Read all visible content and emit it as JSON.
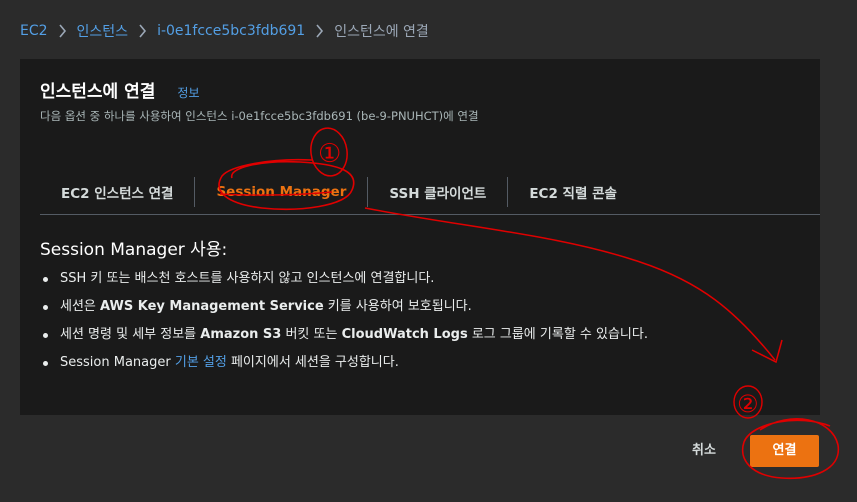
{
  "breadcrumb": {
    "items": [
      "EC2",
      "인스턴스",
      "i-0e1fcce5bc3fdb691",
      "인스턴스에 연결"
    ]
  },
  "panel": {
    "title": "인스턴스에 연결",
    "info_link": "정보",
    "description": "다음 옵션 중 하나를 사용하여 인스턴스 i-0e1fcce5bc3fdb691 (be-9-PNUHCT)에 연결"
  },
  "tabs": [
    {
      "label": "EC2 인스턴스 연결",
      "active": false
    },
    {
      "label": "Session Manager",
      "active": true
    },
    {
      "label": "SSH 클라이언트",
      "active": false
    },
    {
      "label": "EC2 직렬 콘솔",
      "active": false
    }
  ],
  "session_manager": {
    "heading": "Session Manager 사용:",
    "bullet1": "SSH 키 또는 배스천 호스트를 사용하지 않고 인스턴스에 연결합니다.",
    "bullet2_prefix": "세션은 ",
    "bullet2_strong": "AWS Key Management Service",
    "bullet2_suffix": " 키를 사용하여 보호됩니다.",
    "bullet3_prefix": "세션 명령 및 세부 정보를 ",
    "bullet3_strong": "Amazon S3",
    "bullet3_mid": " 버킷 또는 ",
    "bullet3_strong2": "CloudWatch Logs",
    "bullet3_suffix": " 로그 그룹에 기록할 수 있습니다.",
    "bullet4_prefix": "Session Manager ",
    "bullet4_link": "기본 설정",
    "bullet4_suffix": " 페이지에서 세션을 구성합니다."
  },
  "footer": {
    "cancel_label": "취소",
    "connect_label": "연결"
  },
  "annotations": {
    "marker1": "①",
    "marker2": "②",
    "color": "#e00000"
  },
  "colors": {
    "accent": "#ec7211",
    "link": "#539fe5",
    "panel_bg": "#1a1a1a",
    "page_bg": "#2b2b2b"
  }
}
